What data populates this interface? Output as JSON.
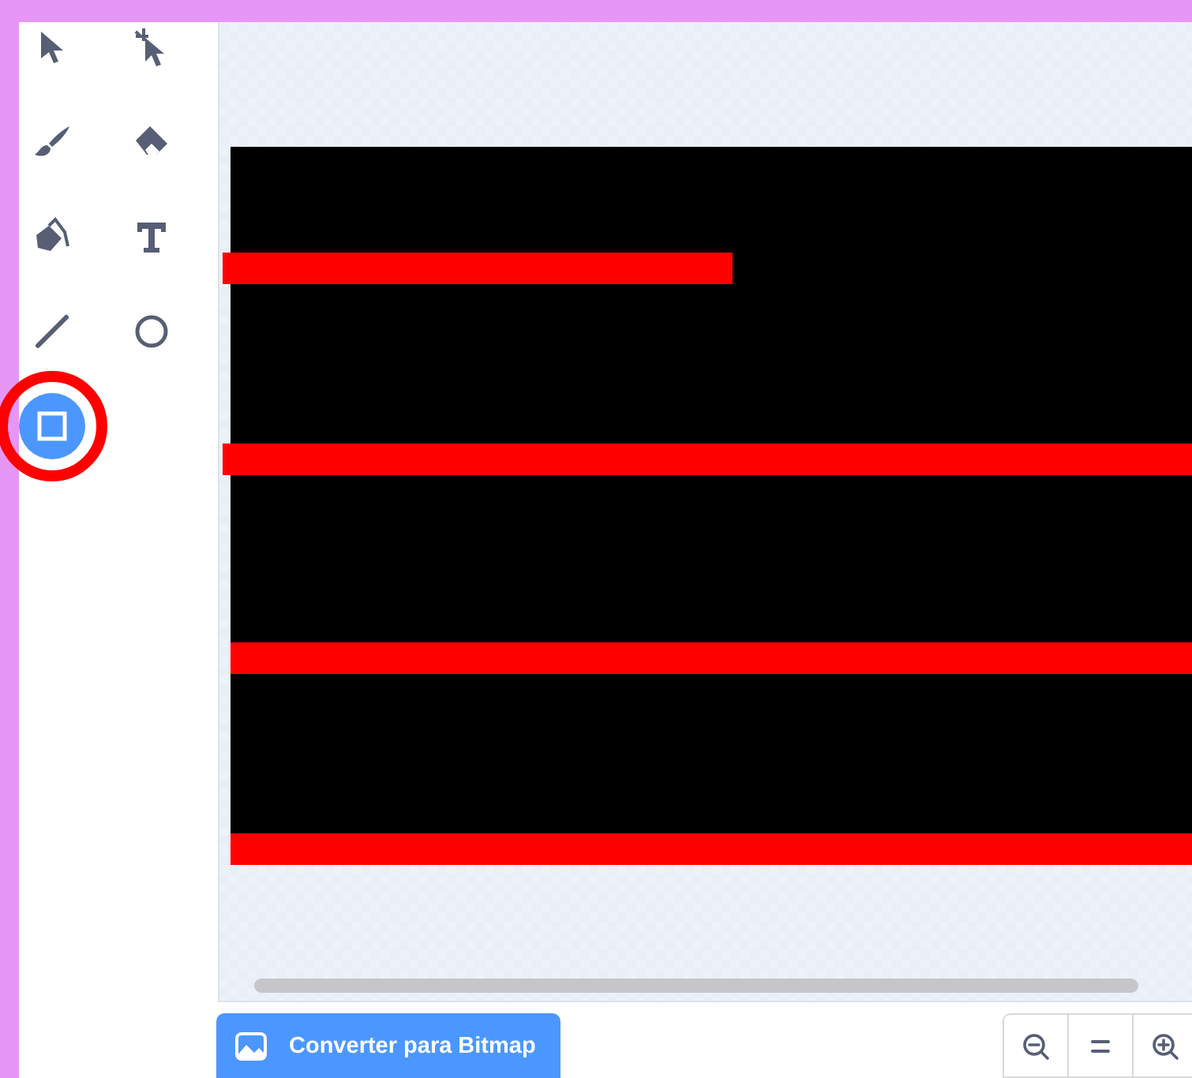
{
  "tools": [
    {
      "kind": "select",
      "selected": false,
      "circled": false
    },
    {
      "kind": "reshape",
      "selected": false,
      "circled": false
    },
    {
      "kind": "brush",
      "selected": false,
      "circled": false
    },
    {
      "kind": "eraser",
      "selected": false,
      "circled": false
    },
    {
      "kind": "fill",
      "selected": false,
      "circled": false
    },
    {
      "kind": "text",
      "selected": false,
      "circled": false
    },
    {
      "kind": "line",
      "selected": false,
      "circled": false
    },
    {
      "kind": "circle",
      "selected": false,
      "circled": false
    },
    {
      "kind": "rectangle",
      "selected": true,
      "circled": true
    }
  ],
  "convert_button": {
    "label": "Converter para Bitmap"
  },
  "zoom_controls": [
    {
      "kind": "zoom-out"
    },
    {
      "kind": "reset"
    },
    {
      "kind": "zoom-in"
    }
  ]
}
